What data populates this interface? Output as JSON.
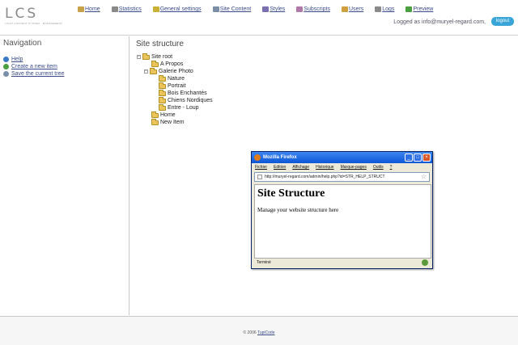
{
  "header": {
    "logo_text": "LCS",
    "logo_subtitle": "LIGHT CONTENT SYSTEM · MANAGEMENT",
    "nav": [
      {
        "label": "Home",
        "icon": "home-icon",
        "color": "#c8a24a"
      },
      {
        "label": "Statistics",
        "icon": "statistics-icon",
        "color": "#8a8a8a"
      },
      {
        "label": "General settings",
        "icon": "settings-icon",
        "color": "#c9b036"
      },
      {
        "label": "Site Content",
        "icon": "site-content-icon",
        "color": "#7a8ea8"
      },
      {
        "label": "Styles",
        "icon": "styles-icon",
        "color": "#7a6fb0"
      },
      {
        "label": "Subscripts",
        "icon": "subscripts-icon",
        "color": "#b07aa8"
      },
      {
        "label": "Users",
        "icon": "users-icon",
        "color": "#d0a040"
      },
      {
        "label": "Logs",
        "icon": "logs-icon",
        "color": "#8a8a8a"
      },
      {
        "label": "Preview",
        "icon": "preview-icon",
        "color": "#4aa040"
      }
    ],
    "logged_as": "Logged as info@muryel-regard.com,",
    "logout_label": "logout"
  },
  "sidebar": {
    "title": "Navigation",
    "links": [
      {
        "label": "Help",
        "icon": "help-icon",
        "color": "#3a78c8"
      },
      {
        "label": "Create a new item",
        "icon": "add-icon",
        "color": "#4aa040"
      },
      {
        "label": "Save the current tree",
        "icon": "save-icon",
        "color": "#7a8ea8"
      }
    ]
  },
  "main": {
    "title": "Site structure",
    "tree": [
      {
        "label": "Site root",
        "level": 0,
        "toggle": "−"
      },
      {
        "label": "A Propos",
        "level": 1,
        "toggle": ""
      },
      {
        "label": "Galerie Photo",
        "level": 1,
        "toggle": "−"
      },
      {
        "label": "Nature",
        "level": 2,
        "toggle": ""
      },
      {
        "label": "Portrait",
        "level": 2,
        "toggle": ""
      },
      {
        "label": "Bois Enchantés",
        "level": 2,
        "toggle": ""
      },
      {
        "label": "Chiens Nordiques",
        "level": 2,
        "toggle": ""
      },
      {
        "label": "Entre - Loup",
        "level": 2,
        "toggle": ""
      },
      {
        "label": "Home",
        "level": 1,
        "toggle": ""
      },
      {
        "label": "New Item",
        "level": 1,
        "toggle": ""
      }
    ]
  },
  "popup": {
    "window_title": "Mozilla Firefox",
    "menu": [
      "Fichier",
      "Edition",
      "Affichage",
      "Historique",
      "Marque-pages",
      "Outils",
      "?"
    ],
    "url": "http://muryel-regard.com/admin/help.php?id=STR_HELP_STRUCT",
    "heading": "Site Structure",
    "body": "Manage your website structure here",
    "status": "Terminé"
  },
  "footer": {
    "copyright": "© 2006",
    "company": "TupiCode"
  }
}
